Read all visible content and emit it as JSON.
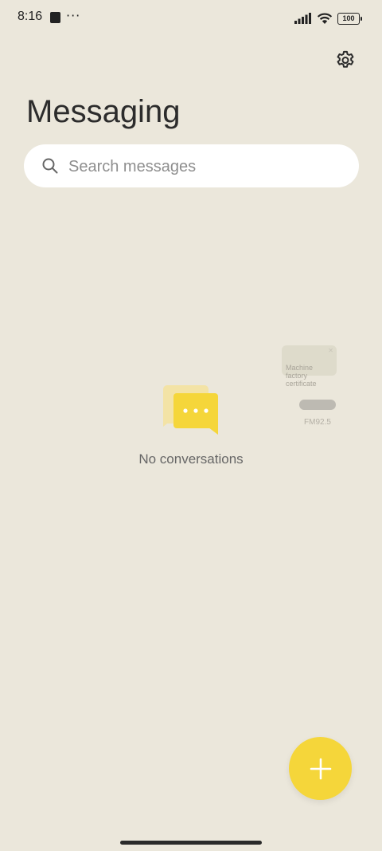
{
  "status_bar": {
    "time": "8:16",
    "more_indicator": "···",
    "battery_level": "100",
    "icons": [
      "app-notification-icon",
      "signal-icon",
      "wifi-icon",
      "battery-icon"
    ]
  },
  "header": {
    "title": "Messaging",
    "settings_icon": "gear-icon"
  },
  "search": {
    "placeholder": "Search messages",
    "value": "",
    "icon": "search-icon"
  },
  "empty_state": {
    "text": "No conversations",
    "icon": "chat-bubbles-icon"
  },
  "floating_widgets": {
    "note_text": "Machine\nfactory\ncertificate",
    "radio_label": "FM92.5"
  },
  "fab": {
    "icon": "plus-icon"
  },
  "colors": {
    "background": "#ebe7db",
    "accent": "#f5d63a",
    "search_bg": "#ffffff"
  }
}
